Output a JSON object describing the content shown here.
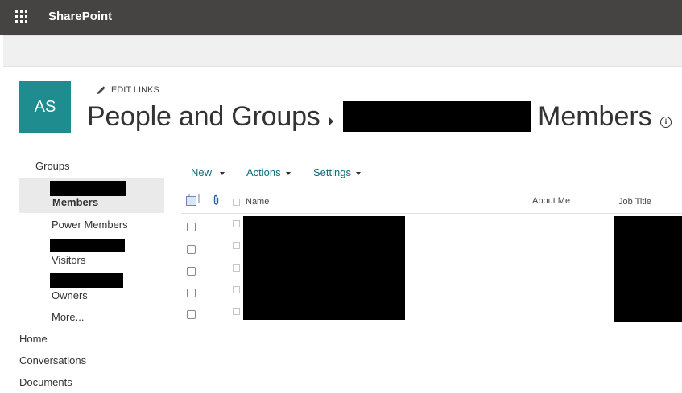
{
  "suite_bar": {
    "app_title": "SharePoint",
    "launcher_icon": "app-launcher-waffle-icon"
  },
  "site": {
    "logo_text": "AS",
    "edit_links_label": "EDIT LINKS"
  },
  "page": {
    "title_prefix": "People and Groups",
    "title_suffix": "Members",
    "info_glyph": "i"
  },
  "left_nav": {
    "section_label": "Groups",
    "groups": [
      {
        "label": "Members",
        "selected": true
      },
      {
        "label": "Power Members",
        "selected": false
      },
      {
        "label": "Visitors",
        "selected": false
      },
      {
        "label": "Owners",
        "selected": false
      },
      {
        "label": "More...",
        "selected": false
      }
    ],
    "links": [
      "Home",
      "Conversations",
      "Documents"
    ]
  },
  "toolbar": {
    "new_label": "New",
    "actions_label": "Actions",
    "settings_label": "Settings"
  },
  "list": {
    "columns": {
      "name": "Name",
      "about_me": "About Me",
      "job_title": "Job Title"
    },
    "row_count": 5
  },
  "colors": {
    "suite_bar": "#464442",
    "logo_bg": "#1f8c8f",
    "link": "#0f6a80",
    "selected_nav_bg": "#eaeaea"
  }
}
